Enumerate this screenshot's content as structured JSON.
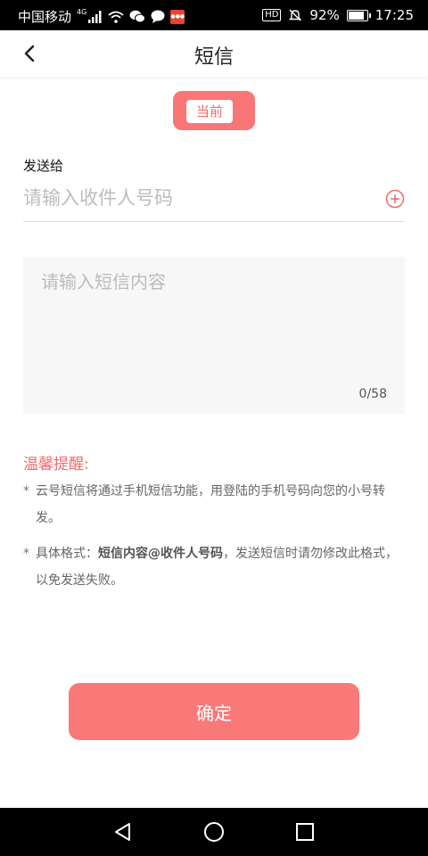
{
  "status_bar": {
    "carrier": "中国移动",
    "network": "4G",
    "battery": "92%",
    "battery_level": 0.92,
    "time": "17:25",
    "icons": [
      "signal-icon",
      "wifi-icon",
      "wechat-icon",
      "message-bubble-icon",
      "weibo-icon",
      "hd-icon",
      "mute-bell-icon",
      "battery-icon"
    ]
  },
  "header": {
    "title": "短信",
    "back_icon": "chevron-left-icon"
  },
  "current_tag": "当前",
  "recipient": {
    "label": "发送给",
    "placeholder": "请输入收件人号码",
    "value": "",
    "add_icon": "plus-circle-icon"
  },
  "message": {
    "placeholder": "请输入短信内容",
    "value": "",
    "counter": "0/58"
  },
  "tips": {
    "title": "温馨提醒:",
    "items": [
      {
        "bullet": "*",
        "text": "云号短信将通过手机短信功能，用登陆的手机号码向您的小号转发。"
      },
      {
        "bullet": "*",
        "prefix": "具体格式：",
        "bold": "短信内容@收件人号码",
        "suffix": "，发送短信时请勿修改此格式，以免发送失败。"
      }
    ]
  },
  "confirm_label": "确定",
  "colors": {
    "accent": "#f97979",
    "accent_text": "#f26a6a",
    "placeholder": "#bcbcbc"
  },
  "nav_bar": {
    "icons": [
      "back-triangle-icon",
      "home-circle-icon",
      "recents-square-icon"
    ]
  }
}
